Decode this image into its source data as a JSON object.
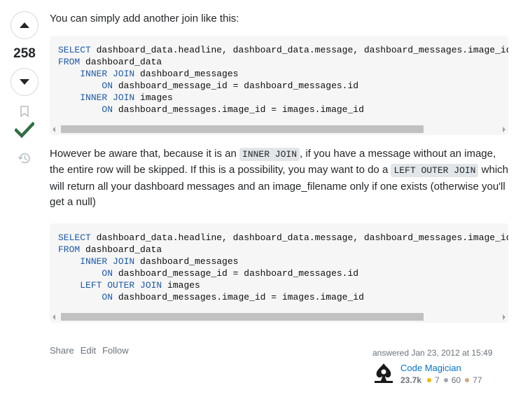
{
  "votes": {
    "score": "258"
  },
  "answer": {
    "intro": "You can simply add another join like this:",
    "code1": [
      [
        {
          "k": true,
          "t": "SELECT"
        },
        {
          "k": false,
          "t": " dashboard_data.headline, dashboard_data.message, dashboard_messages.image_id, "
        }
      ],
      [
        {
          "k": true,
          "t": "FROM"
        },
        {
          "k": false,
          "t": " dashboard_data"
        }
      ],
      [
        {
          "k": false,
          "t": "    "
        },
        {
          "k": true,
          "t": "INNER JOIN"
        },
        {
          "k": false,
          "t": " dashboard_messages"
        }
      ],
      [
        {
          "k": false,
          "t": "        "
        },
        {
          "k": true,
          "t": "ON"
        },
        {
          "k": false,
          "t": " dashboard_message_id = dashboard_messages.id"
        }
      ],
      [
        {
          "k": false,
          "t": "    "
        },
        {
          "k": true,
          "t": "INNER JOIN"
        },
        {
          "k": false,
          "t": " images"
        }
      ],
      [
        {
          "k": false,
          "t": "        "
        },
        {
          "k": true,
          "t": "ON"
        },
        {
          "k": false,
          "t": " dashboard_messages.image_id = images.image_id"
        }
      ]
    ],
    "para2": {
      "part1": "However be aware that, because it is an ",
      "code_a": "INNER JOIN",
      "part2": ", if you have a message without an image, the entire row will be skipped. If this is a possibility, you may want to do a ",
      "code_b": "LEFT OUTER JOIN",
      "part3": " which will return all your dashboard messages and an image_filename only if one exists (otherwise you'll get a null)"
    },
    "code2": [
      [
        {
          "k": true,
          "t": "SELECT"
        },
        {
          "k": false,
          "t": " dashboard_data.headline, dashboard_data.message, dashboard_messages.image_id, "
        }
      ],
      [
        {
          "k": true,
          "t": "FROM"
        },
        {
          "k": false,
          "t": " dashboard_data"
        }
      ],
      [
        {
          "k": false,
          "t": "    "
        },
        {
          "k": true,
          "t": "INNER JOIN"
        },
        {
          "k": false,
          "t": " dashboard_messages"
        }
      ],
      [
        {
          "k": false,
          "t": "        "
        },
        {
          "k": true,
          "t": "ON"
        },
        {
          "k": false,
          "t": " dashboard_message_id = dashboard_messages.id"
        }
      ],
      [
        {
          "k": false,
          "t": "    "
        },
        {
          "k": true,
          "t": "LEFT OUTER JOIN"
        },
        {
          "k": false,
          "t": " images"
        }
      ],
      [
        {
          "k": false,
          "t": "        "
        },
        {
          "k": true,
          "t": "ON"
        },
        {
          "k": false,
          "t": " dashboard_messages.image_id = images.image_id"
        }
      ]
    ]
  },
  "menu": {
    "share": "Share",
    "edit": "Edit",
    "follow": "Follow"
  },
  "user": {
    "action": "answered Jan 23, 2012 at 15:49",
    "name": "Code Magician",
    "reputation": "23.7k",
    "gold": "7",
    "silver": "60",
    "bronze": "77"
  },
  "colors": {
    "keyword": "#1e5aa8",
    "accepted": "#2f6f44",
    "link": "#0074cc",
    "gold": "#f1b600",
    "silver": "#9fa6ad",
    "bronze": "#d1a684"
  },
  "icons": {
    "upvote": "triangle-up-icon",
    "downvote": "triangle-down-icon",
    "bookmark": "bookmark-icon",
    "accepted": "checkmark-icon",
    "history": "history-icon"
  }
}
